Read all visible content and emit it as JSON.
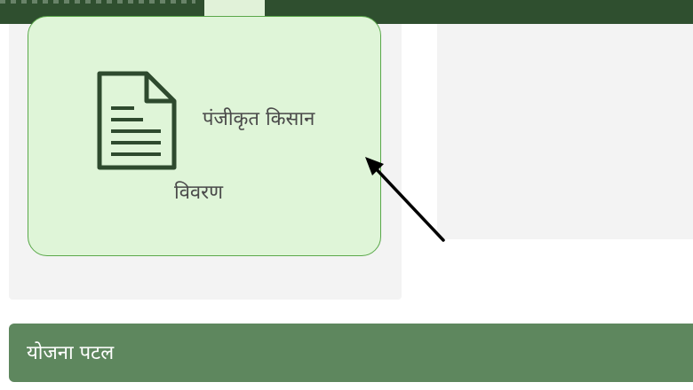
{
  "top_bar": {
    "background_color": "#2f4f2f",
    "active_tab_color": "#e1f2d9"
  },
  "farmer_card": {
    "label_line1": "पंजीकृत किसान",
    "label_line2": "विवरण",
    "icon": "document-icon",
    "background_color": "#dff5d8",
    "border_color": "#5aa84a"
  },
  "scheme_panel": {
    "title": "योजना पटल",
    "background_color": "#5e875e"
  },
  "annotation": {
    "icon": "arrow-pointer-icon",
    "color": "#000000"
  }
}
